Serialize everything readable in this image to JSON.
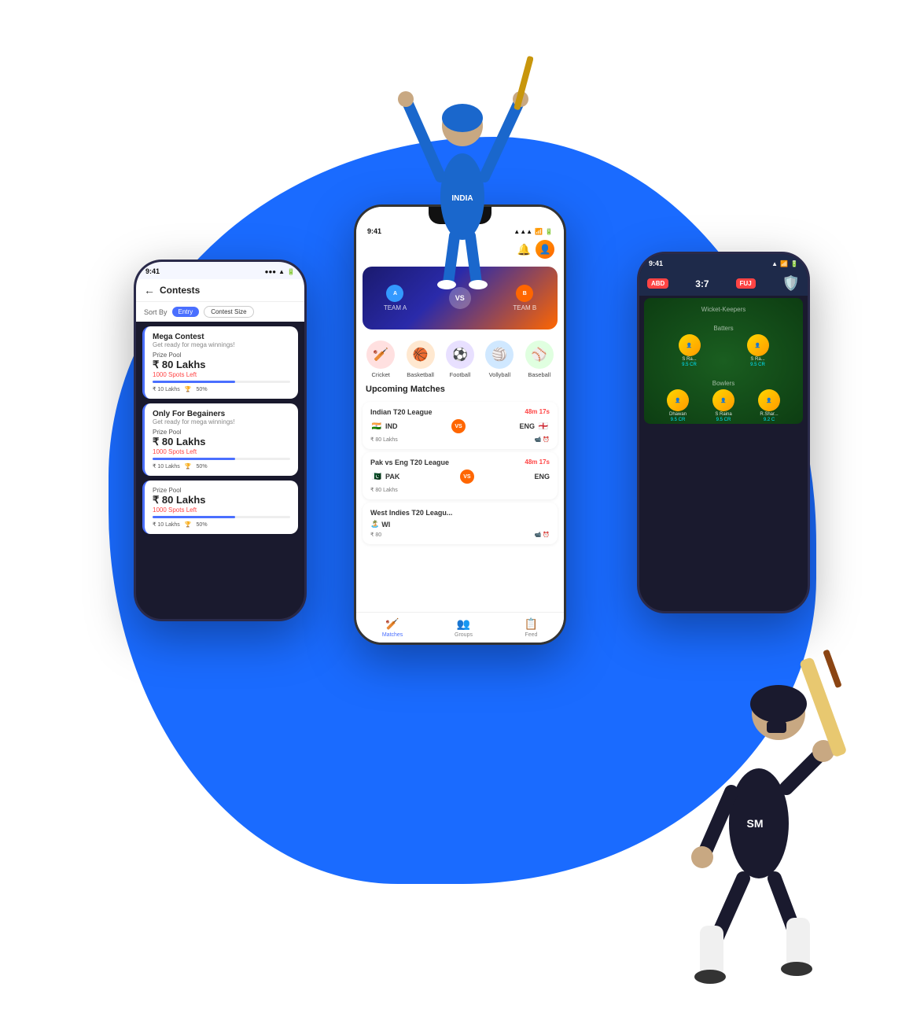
{
  "background": {
    "blob_color": "#1a6bff"
  },
  "left_phone": {
    "status_time": "9:41",
    "header": {
      "back_label": "←",
      "title": "Contests"
    },
    "sort": {
      "label": "Sort By",
      "options": [
        "Entry",
        "Contest Size"
      ]
    },
    "contests": [
      {
        "title": "Mega Contest",
        "subtitle": "Get ready for mega winnings!",
        "prize_label": "Prize Pool",
        "prize_amount": "₹ 80 Lakhs",
        "spots_left": "1000 Spots Left",
        "entry": "₹ 10 Lakhs",
        "percentage": "50%"
      },
      {
        "title": "Only For Begainers",
        "subtitle": "Get ready for mega winnings!",
        "prize_label": "Prize Pool",
        "prize_amount": "₹ 80 Lakhs",
        "spots_left": "1000 Spots Left",
        "entry": "₹ 10 Lakhs",
        "percentage": "50%"
      },
      {
        "title": "Prize Pool",
        "subtitle": "",
        "prize_label": "Prize Pool",
        "prize_amount": "₹ 80 Lakhs",
        "spots_left": "1000 Spots Left",
        "entry": "₹ 10 Lakhs",
        "percentage": "50%"
      }
    ]
  },
  "center_phone": {
    "status_time": "9:41",
    "match_banner": {
      "team_a": "TEAM A",
      "team_b": "TEAM B",
      "vs": "VS"
    },
    "sports": [
      {
        "name": "Cricket",
        "icon": "🏏",
        "bg": "#ffe0e0"
      },
      {
        "name": "Basketball",
        "icon": "🏀",
        "bg": "#ffe8d0"
      },
      {
        "name": "Football",
        "icon": "⚽",
        "bg": "#e8e0ff"
      },
      {
        "name": "Vollyball",
        "icon": "🏐",
        "bg": "#d0e8ff"
      },
      {
        "name": "Baseball",
        "icon": "⚾",
        "bg": "#e0ffe0"
      }
    ],
    "section_title": "Upcoming Matches",
    "matches": [
      {
        "league": "Indian T20 League",
        "timer": "48m 17s",
        "team1": "IND",
        "team1_flag": "🇮🇳",
        "team2": "ENG",
        "team2_flag": "🏴󠁧󠁢󠁥󠁮󠁧󠁿",
        "prize": "₹ 80 Lakhs"
      },
      {
        "league": "Pak vs Eng T20 League",
        "timer": "48m 17s",
        "team1": "PAK",
        "team1_flag": "🇵🇰",
        "team2": "ENG",
        "team2_flag": "🏴󠁧󠁢󠁥󠁮󠁧󠁿",
        "prize": "₹ 80 Lakhs"
      },
      {
        "league": "West Indies T20 Leagu...",
        "timer": "",
        "team1": "WI",
        "team1_flag": "🏝️",
        "team2": "",
        "team2_flag": "",
        "prize": "₹ 80"
      }
    ],
    "nav": [
      {
        "label": "Matches",
        "icon": "🏏",
        "active": true
      },
      {
        "label": "Groups",
        "icon": "👥",
        "active": false
      },
      {
        "label": "Feed",
        "icon": "📋",
        "active": false
      }
    ]
  },
  "right_phone": {
    "status_time": "9:41",
    "header": {
      "team1_abbr": "ABD",
      "score": "3:7",
      "team2_abbr": "FUJ"
    },
    "sections": {
      "wicket_keepers": "Wicket-Keepers",
      "batters": "Batters",
      "bowlers": "Bowlers"
    },
    "players": {
      "batters": [
        {
          "name": "S Ra...",
          "pts": "9.5 CR"
        },
        {
          "name": "S Ra...",
          "pts": "9.5 CR"
        }
      ],
      "bowlers": [
        {
          "name": "Dhawan",
          "pts": "9.5 CR"
        },
        {
          "name": "S Raina",
          "pts": "9.5 CR"
        },
        {
          "name": "R.Shar...",
          "pts": "9.2 C"
        }
      ]
    }
  }
}
